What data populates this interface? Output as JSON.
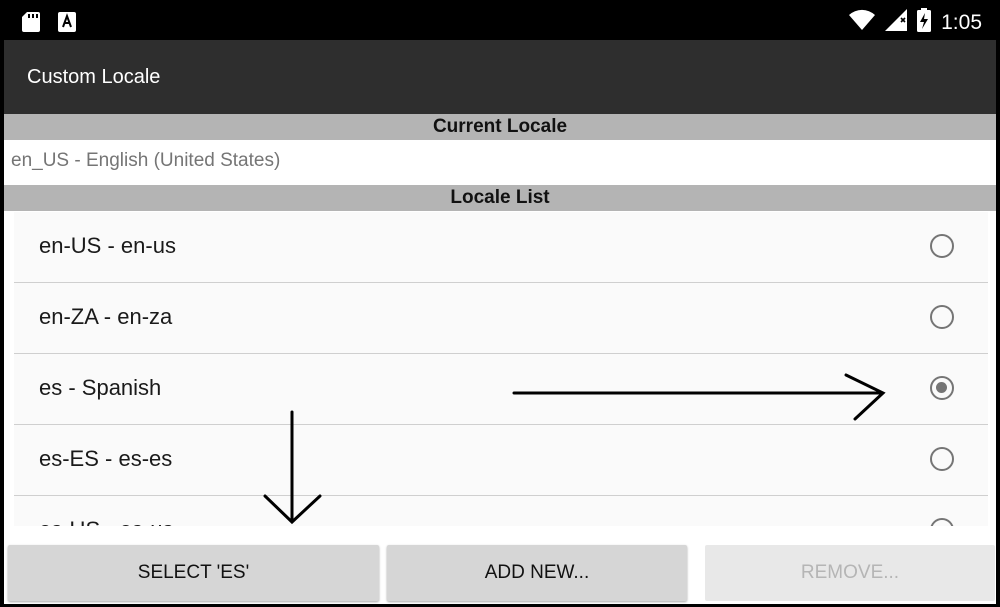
{
  "status_bar": {
    "time": "1:05",
    "left_icons": [
      "sd-card-icon",
      "keyboard-a-icon"
    ],
    "right_icons": [
      "wifi-icon",
      "signal-icon",
      "battery-charging-icon"
    ]
  },
  "toolbar": {
    "title": "Custom Locale"
  },
  "current_locale": {
    "header": "Current Locale",
    "value": "en_US - English (United States)"
  },
  "locale_list": {
    "header": "Locale List",
    "items": [
      {
        "label": "en-US - en-us",
        "selected": false
      },
      {
        "label": "en-ZA - en-za",
        "selected": false
      },
      {
        "label": "es - Spanish",
        "selected": true
      },
      {
        "label": "es-ES - es-es",
        "selected": false
      },
      {
        "label": "es-US - es-us",
        "selected": false
      }
    ]
  },
  "buttons": {
    "select": "SELECT 'ES'",
    "add_new": "ADD NEW...",
    "remove": "REMOVE..."
  },
  "colors": {
    "status_bar": "#000000",
    "toolbar": "#2e2e2e",
    "section_header": "#b4b4b4",
    "radio": "#757575",
    "button": "#d6d6d6"
  }
}
